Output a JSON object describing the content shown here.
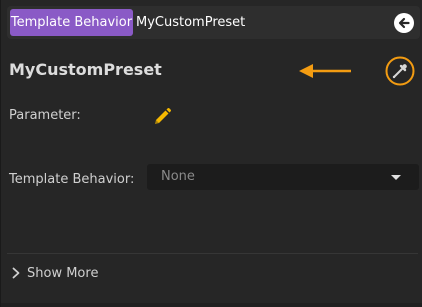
{
  "breadcrumb": {
    "type_label": "Template Behavior",
    "name": "MyCustomPreset",
    "back_icon": "back-arrow-icon"
  },
  "header": {
    "title": "MyCustomPreset",
    "eyedropper_icon": "eyedropper-icon",
    "annotation_icon": "arrow-left-annotation-icon"
  },
  "fields": {
    "parameter_label": "Parameter:",
    "parameter_icon": "pencil-icon",
    "template_behavior_label": "Template Behavior:",
    "template_behavior_value": "None"
  },
  "footer": {
    "show_more_label": "Show More"
  },
  "colors": {
    "badge": "#8a5ac6",
    "accent": "#f39c12",
    "panel": "#262626"
  }
}
